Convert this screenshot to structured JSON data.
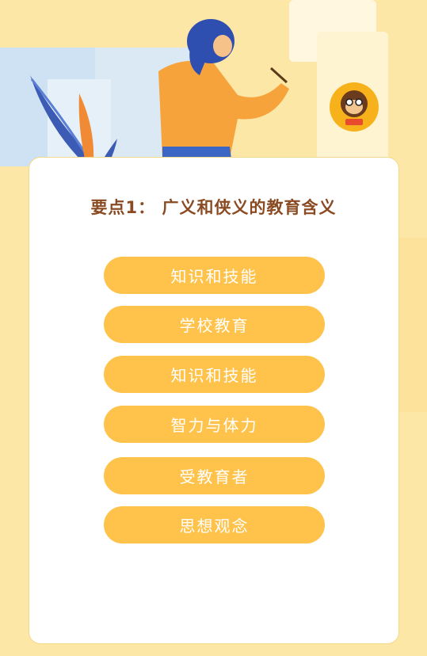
{
  "header": {
    "logo_icon": "monkey-mascot-logo-icon",
    "illustration": "woman-writing-on-paper-illustration"
  },
  "card": {
    "title": "要点1： 广义和侠义的教育含义",
    "options": [
      {
        "label": "知识和技能"
      },
      {
        "label": "学校教育"
      },
      {
        "label": "知识和技能"
      },
      {
        "label": "智力与体力"
      },
      {
        "label": "受教育者"
      },
      {
        "label": "思想观念"
      }
    ]
  },
  "colors": {
    "background": "#fde7a6",
    "card": "#ffffff",
    "title": "#8a4a22",
    "pill": "#ffc24a",
    "pill_text": "#ffffff"
  }
}
